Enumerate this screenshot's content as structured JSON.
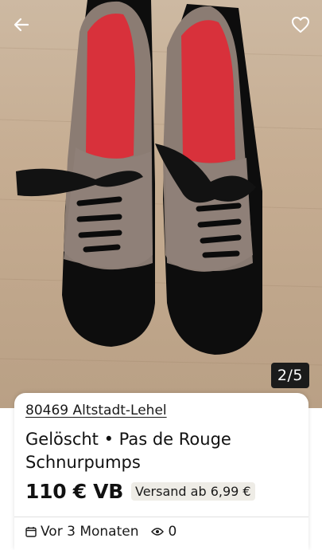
{
  "header": {
    "back_icon": "arrow-left-icon",
    "favorite_icon": "heart-outline-icon"
  },
  "gallery": {
    "counter": "2/5"
  },
  "listing": {
    "location": "80469 Altstadt-Lehel",
    "title": "Gelöscht • Pas de Rouge Schnurpumps",
    "price": "110 € VB",
    "shipping": "Versand ab 6,99 €",
    "posted": "Vor 3 Monaten",
    "views": "0"
  },
  "colors": {
    "accent": "#1b1b1b",
    "background": "#ffffff",
    "badge_bg": "#eeece6"
  }
}
